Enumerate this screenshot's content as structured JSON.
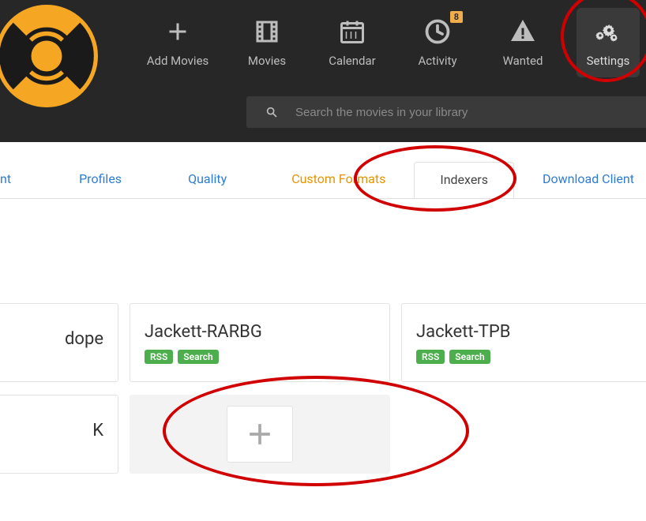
{
  "nav": {
    "items": [
      {
        "label": "Add Movies"
      },
      {
        "label": "Movies"
      },
      {
        "label": "Calendar"
      },
      {
        "label": "Activity",
        "badge": "8"
      },
      {
        "label": "Wanted"
      },
      {
        "label": "Settings"
      }
    ]
  },
  "search": {
    "placeholder": "Search the movies in your library"
  },
  "subtabs": {
    "partial_left": "nt",
    "profiles": "Profiles",
    "quality": "Quality",
    "custom_formats": "Custom Formats",
    "indexers": "Indexers",
    "download_client": "Download Client"
  },
  "badges": {
    "rss": "RSS",
    "search": "Search"
  },
  "indexers": [
    {
      "name": "dope",
      "partial": true
    },
    {
      "name": "Jackett-RARBG"
    },
    {
      "name": "Jackett-TPB"
    },
    {
      "name": "K",
      "partial": true
    }
  ]
}
